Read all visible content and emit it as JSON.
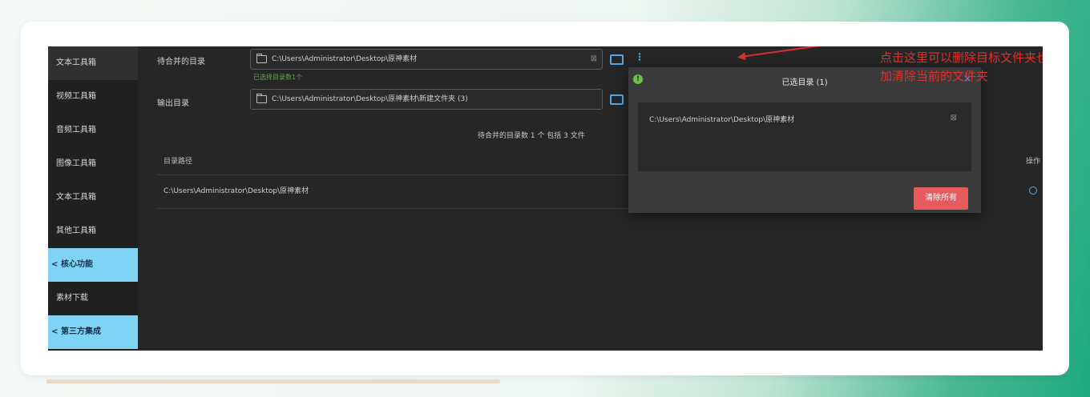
{
  "sidebar": {
    "items": [
      {
        "label": "文本工具箱"
      },
      {
        "label": "视频工具箱"
      },
      {
        "label": "音频工具箱"
      },
      {
        "label": "图像工具箱"
      },
      {
        "label": "文本工具箱"
      },
      {
        "label": "其他工具箱"
      }
    ],
    "core_group": {
      "label": "核心功能"
    },
    "core_items": [
      {
        "label": "素材下载"
      }
    ],
    "third_group": {
      "label": "第三方集成"
    }
  },
  "source": {
    "label": "待合并的目录",
    "path": "C:\\Users\\Administrator\\Desktop\\原神素材",
    "hint": "已选择目录数1个"
  },
  "output": {
    "label": "输出目录",
    "path": "C:\\Users\\Administrator\\Desktop\\原神素材\\新建文件夹 (3)"
  },
  "summary": {
    "text": "待合并的目录数 1 个  包括 3 文件"
  },
  "table": {
    "header_path": "目录路径",
    "header_action": "操作",
    "rows": [
      {
        "path": "C:\\Users\\Administrator\\Desktop\\原神素材"
      }
    ]
  },
  "popup": {
    "title": "已选目录 (1)",
    "items": [
      {
        "path": "C:\\Users\\Administrator\\Desktop\\原神素材"
      }
    ],
    "clear_label": "清除所有"
  },
  "annotation": {
    "line1": "点击这里可以删除目标文件夹也可以添",
    "line2": "加清除当前的文件夹"
  },
  "colors": {
    "accent_blue": "#56a7e6",
    "sidebar_highlight": "#7fd3f5",
    "danger": "#e55a5e",
    "annotation_red": "#e0302c"
  }
}
